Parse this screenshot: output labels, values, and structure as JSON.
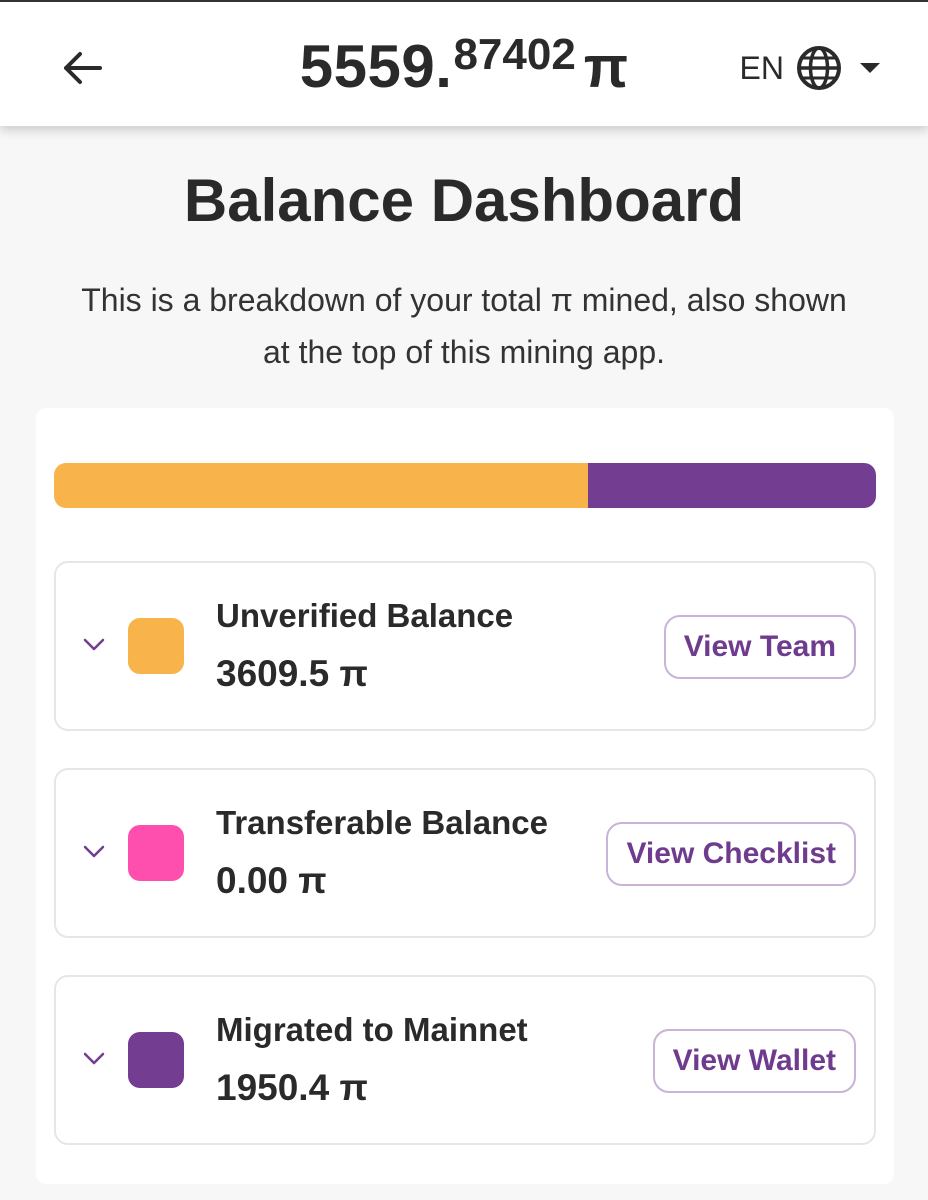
{
  "header": {
    "back_icon": "arrow-left-icon",
    "balance_int": "5559.",
    "balance_dec": "87402",
    "balance_unit": "π",
    "language": "EN",
    "globe_icon": "globe-icon",
    "dropdown_icon": "caret-down-icon"
  },
  "page": {
    "title": "Balance Dashboard",
    "subtitle": "This is a breakdown of your total π mined, also shown at the top of this mining app."
  },
  "breakdown_bar": {
    "segments": [
      {
        "name": "Unverified Balance",
        "value": 3609.5,
        "color": "#f9b34b"
      },
      {
        "name": "Transferable Balance",
        "value": 0.0,
        "color": "#ff4fae"
      },
      {
        "name": "Migrated to Mainnet",
        "value": 1950.4,
        "color": "#733d91"
      }
    ]
  },
  "rows": [
    {
      "label": "Unverified Balance",
      "value": "3609.5 π",
      "color": "#f9b34b",
      "button": "View Team",
      "chevron_icon": "chevron-down-icon"
    },
    {
      "label": "Transferable Balance",
      "value": "0.00 π",
      "color": "#ff4fae",
      "button": "View Checklist",
      "chevron_icon": "chevron-down-icon"
    },
    {
      "label": "Migrated to Mainnet",
      "value": "1950.4 π",
      "color": "#733d91",
      "button": "View Wallet",
      "chevron_icon": "chevron-down-icon"
    }
  ],
  "colors": {
    "accent": "#6f3b8e",
    "button_border": "#c9b3d6"
  }
}
